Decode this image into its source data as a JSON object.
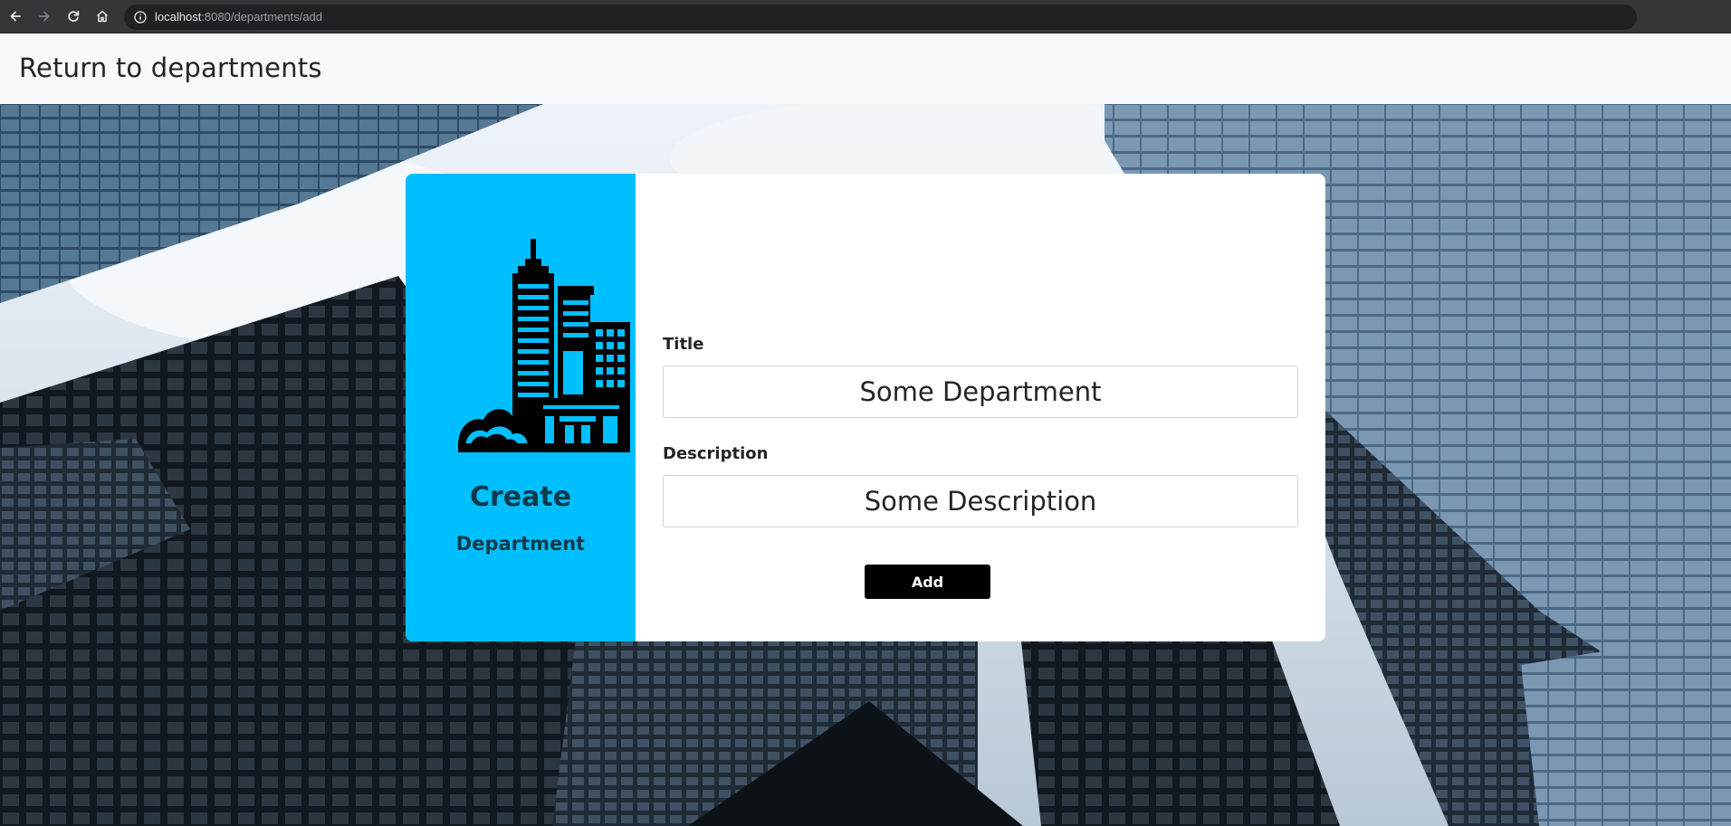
{
  "browser": {
    "url_host": "localhost",
    "url_rest": ":8080/departments/add",
    "icons": [
      "back-arrow-icon",
      "forward-arrow-icon",
      "reload-icon",
      "home-icon",
      "info-icon"
    ]
  },
  "navbar": {
    "return_link": "Return to departments"
  },
  "card": {
    "accent_color": "#00bfff",
    "icon": "city-buildings-icon",
    "heading": "Create",
    "subheading": "Department",
    "fields": {
      "title": {
        "label": "Title",
        "value": "Some Department"
      },
      "description": {
        "label": "Description",
        "value": "Some Description"
      }
    },
    "submit_label": "Add"
  }
}
